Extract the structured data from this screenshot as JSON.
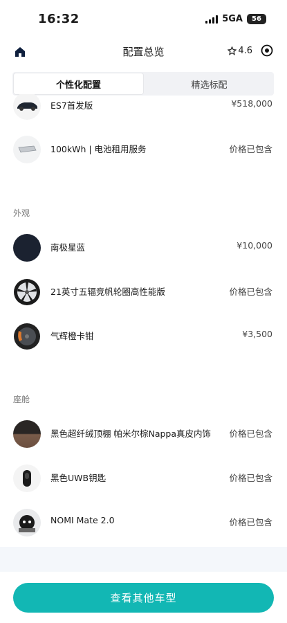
{
  "status_bar": {
    "time": "16:32",
    "network": "5GA",
    "battery": "56"
  },
  "nav": {
    "title": "配置总览",
    "rating": "4.6",
    "icons": [
      "home-icon",
      "star-icon",
      "target-icon"
    ]
  },
  "tabs": [
    {
      "label": "个性化配置",
      "active": true
    },
    {
      "label": "精选标配",
      "active": false
    }
  ],
  "base_items": [
    {
      "name": "ES7首发版",
      "price": "¥518,000",
      "icon": "car-thumbnail"
    },
    {
      "name": "100kWh | 电池租用服务",
      "price": "价格已包含",
      "icon": "battery-pack-thumbnail"
    }
  ],
  "exterior": {
    "title": "外观",
    "items": [
      {
        "name": "南极星蓝",
        "price": "¥10,000",
        "icon": "paint-swatch",
        "color": "#1b2230"
      },
      {
        "name": "21英寸五辐竞帆轮圈高性能版",
        "price": "价格已包含",
        "icon": "wheel-thumbnail"
      },
      {
        "name": "气辉橙卡钳",
        "price": "¥3,500",
        "icon": "caliper-thumbnail",
        "accent": "#e07a2c"
      }
    ]
  },
  "cabin": {
    "title": "座舱",
    "items": [
      {
        "name": "黑色超纤绒顶棚 帕米尔棕Nappa真皮内饰",
        "price": "价格已包含",
        "icon": "interior-swatch"
      },
      {
        "name": "黑色UWB钥匙",
        "price": "价格已包含",
        "icon": "key-thumbnail"
      },
      {
        "name": "NOMI Mate 2.0",
        "price": "价格已包含",
        "icon": "nomi-thumbnail"
      }
    ]
  },
  "cta": {
    "label": "查看其他车型"
  },
  "colors": {
    "accent": "#12b7b4",
    "tab_bg": "#f1f2f5"
  }
}
